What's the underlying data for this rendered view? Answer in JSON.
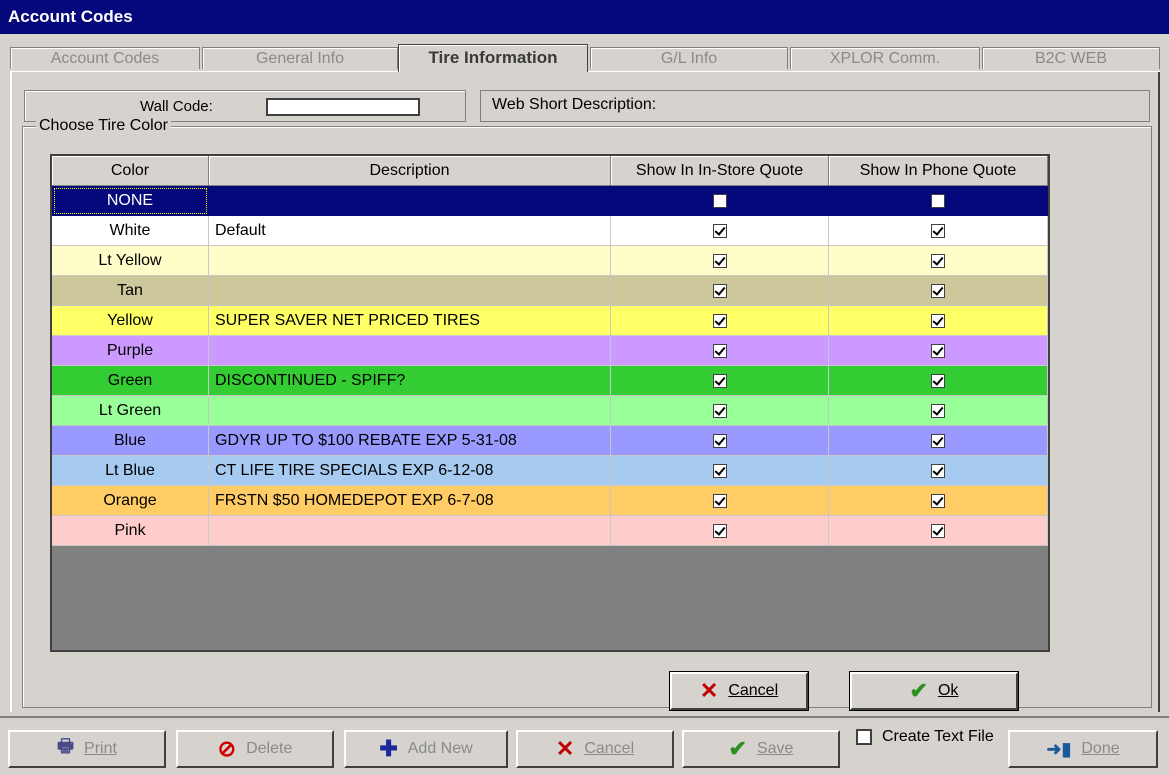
{
  "window": {
    "title": "Account Codes"
  },
  "tabs": [
    {
      "label": "Account Codes"
    },
    {
      "label": "General Info"
    },
    {
      "label": "Tire Information"
    },
    {
      "label": "G/L Info"
    },
    {
      "label": "XPLOR Comm."
    },
    {
      "label": "B2C WEB"
    }
  ],
  "form": {
    "wall_code_label": "Wall Code:",
    "wall_code_value": "",
    "web_short_desc_label": "Web Short Description:"
  },
  "group": {
    "label": "Choose Tire Color"
  },
  "grid": {
    "columns": [
      "Color",
      "Description",
      "Show In In-Store Quote",
      "Show In Phone Quote"
    ],
    "rows": [
      {
        "color": "NONE",
        "description": "",
        "instore": false,
        "phone": false,
        "bg": "#05087a"
      },
      {
        "color": "White",
        "description": "Default",
        "instore": true,
        "phone": true,
        "bg": "#ffffff"
      },
      {
        "color": "Lt Yellow",
        "description": "",
        "instore": true,
        "phone": true,
        "bg": "#fffdc8"
      },
      {
        "color": "Tan",
        "description": "",
        "instore": true,
        "phone": true,
        "bg": "#cdc89c"
      },
      {
        "color": "Yellow",
        "description": "SUPER SAVER NET PRICED TIRES",
        "instore": true,
        "phone": true,
        "bg": "#ffff66"
      },
      {
        "color": "Purple",
        "description": "",
        "instore": true,
        "phone": true,
        "bg": "#cc99ff"
      },
      {
        "color": "Green",
        "description": "DISCONTINUED  - SPIFF?",
        "instore": true,
        "phone": true,
        "bg": "#33cc33"
      },
      {
        "color": "Lt Green",
        "description": "",
        "instore": true,
        "phone": true,
        "bg": "#99ff99"
      },
      {
        "color": "Blue",
        "description": "GDYR UP TO $100 REBATE EXP 5-31-08",
        "instore": true,
        "phone": true,
        "bg": "#9999ff"
      },
      {
        "color": "Lt Blue",
        "description": "CT LIFE TIRE SPECIALS EXP 6-12-08",
        "instore": true,
        "phone": true,
        "bg": "#a6caf0"
      },
      {
        "color": "Orange",
        "description": "FRSTN $50 HOMEDEPOT  EXP 6-7-08",
        "instore": true,
        "phone": true,
        "bg": "#ffcc66"
      },
      {
        "color": "Pink",
        "description": "",
        "instore": true,
        "phone": true,
        "bg": "#ffcccc"
      }
    ]
  },
  "dialog_buttons": {
    "cancel": "Cancel",
    "ok": "Ok"
  },
  "toolbar": {
    "print": "Print",
    "delete": "Delete",
    "add_new": "Add New",
    "cancel": "Cancel",
    "save": "Save",
    "create_text_file": "Create Text File",
    "done": "Done"
  },
  "colors": {
    "title_bar": "#05087a",
    "face": "#d6d3ce",
    "grid_empty": "#808080"
  },
  "icons": {
    "cancel": "x-icon",
    "ok": "check-icon",
    "print": "printer-icon",
    "delete": "no-icon",
    "add_new": "add-icon",
    "save": "check-icon",
    "done": "exit-icon"
  }
}
